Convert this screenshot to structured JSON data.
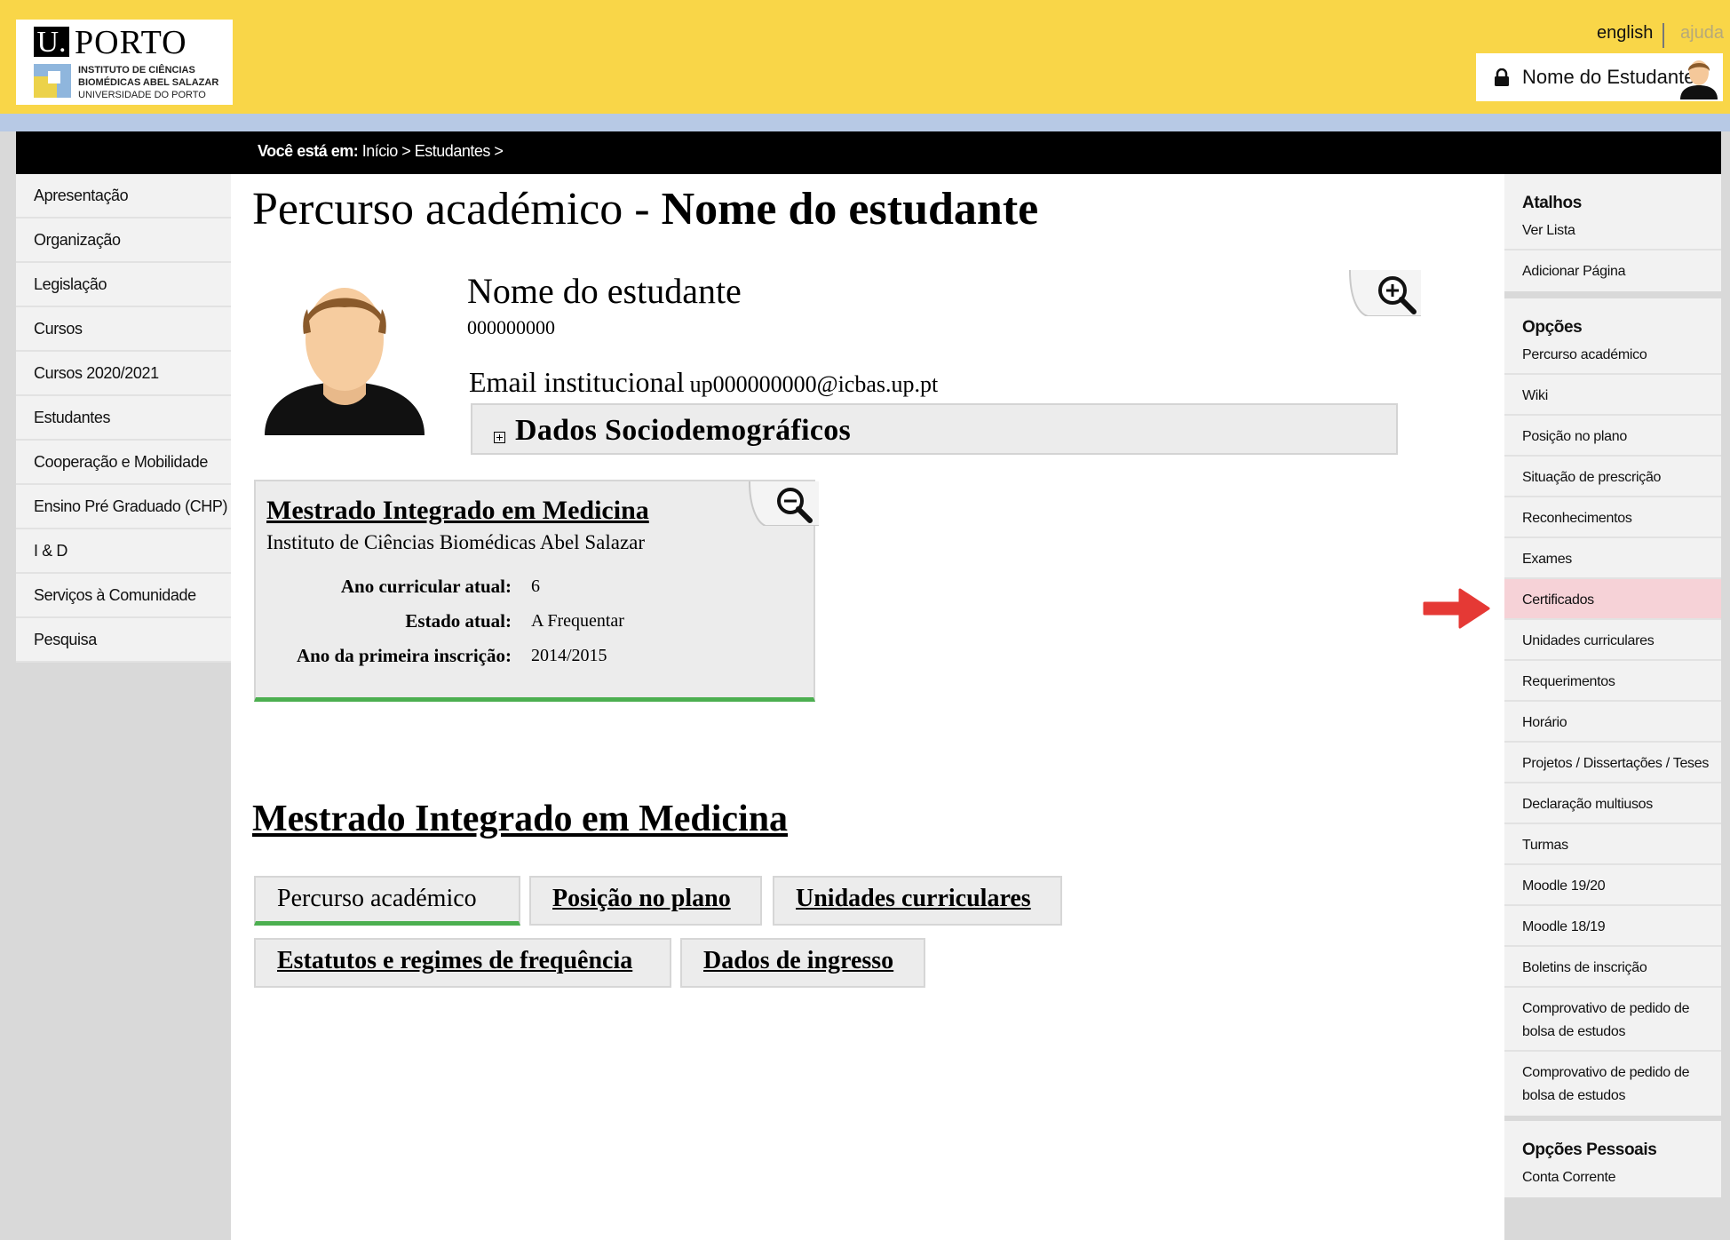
{
  "header": {
    "logo": {
      "u": "U.",
      "porto": "PORTO",
      "institute": [
        "INSTITUTO DE CIÊNCIAS",
        "BIOMÉDICAS ABEL SALAZAR"
      ],
      "university": "UNIVERSIDADE DO PORTO"
    },
    "lang_link": "english",
    "help_link": "ajuda",
    "user_name": "Nome do Estudante"
  },
  "breadcrumb": {
    "prefix": "Você está em:",
    "path": "Início > Estudantes >"
  },
  "left_nav": {
    "items": [
      "Apresentação",
      "Organização",
      "Legislação",
      "Cursos",
      "Cursos 2020/2021",
      "Estudantes",
      "Cooperação e Mobilidade",
      "Ensino Pré Graduado (CHP)",
      "I & D",
      "Serviços à Comunidade",
      "Pesquisa"
    ]
  },
  "page": {
    "title_prefix": "Percurso académico - ",
    "title_name": "Nome do estudante",
    "student_name": "Nome do estudante",
    "student_number": "000000000",
    "email_label": "Email institucional",
    "email_value": "up000000000@icbas.up.pt",
    "socio_label": "Dados Sociodemográficos"
  },
  "course_card": {
    "title": "Mestrado Integrado em Medicina",
    "institution": "Instituto de Ciências Biomédicas Abel Salazar",
    "fields": [
      {
        "label": "Ano curricular atual:",
        "value": "6"
      },
      {
        "label": "Estado atual:",
        "value": "A Frequentar"
      },
      {
        "label": "Ano da primeira inscrição:",
        "value": "2014/2015"
      }
    ]
  },
  "section": {
    "title": "Mestrado Integrado em Medicina",
    "tabs": [
      "Percurso académico",
      "Posição no plano",
      "Unidades curriculares",
      "Estatutos e regimes de frequência",
      "Dados de ingresso"
    ]
  },
  "right_nav": {
    "shortcuts": {
      "heading": "Atalhos",
      "items": [
        "Ver Lista",
        "Adicionar Página"
      ]
    },
    "options": {
      "heading": "Opções",
      "items": [
        "Percurso académico",
        "Wiki",
        "Posição no plano",
        "Situação de prescrição",
        "Reconhecimentos",
        "Exames",
        "Certificados",
        "Unidades curriculares",
        "Requerimentos",
        "Horário",
        "Projetos / Dissertações / Teses",
        "Declaração multiusos",
        "Turmas",
        "Moodle 19/20",
        "Moodle 18/19",
        "Boletins de inscrição",
        "Comprovativo de pedido de bolsa de estudos",
        "Comprovativo de pedido de bolsa de estudos"
      ]
    },
    "personal": {
      "heading": "Opções Pessoais",
      "items": [
        "Conta Corrente"
      ]
    }
  },
  "colors": {
    "header": "#f9d648",
    "accent_green": "#4caf50",
    "highlight": "#f6d2d7",
    "arrow": "#e53935"
  }
}
